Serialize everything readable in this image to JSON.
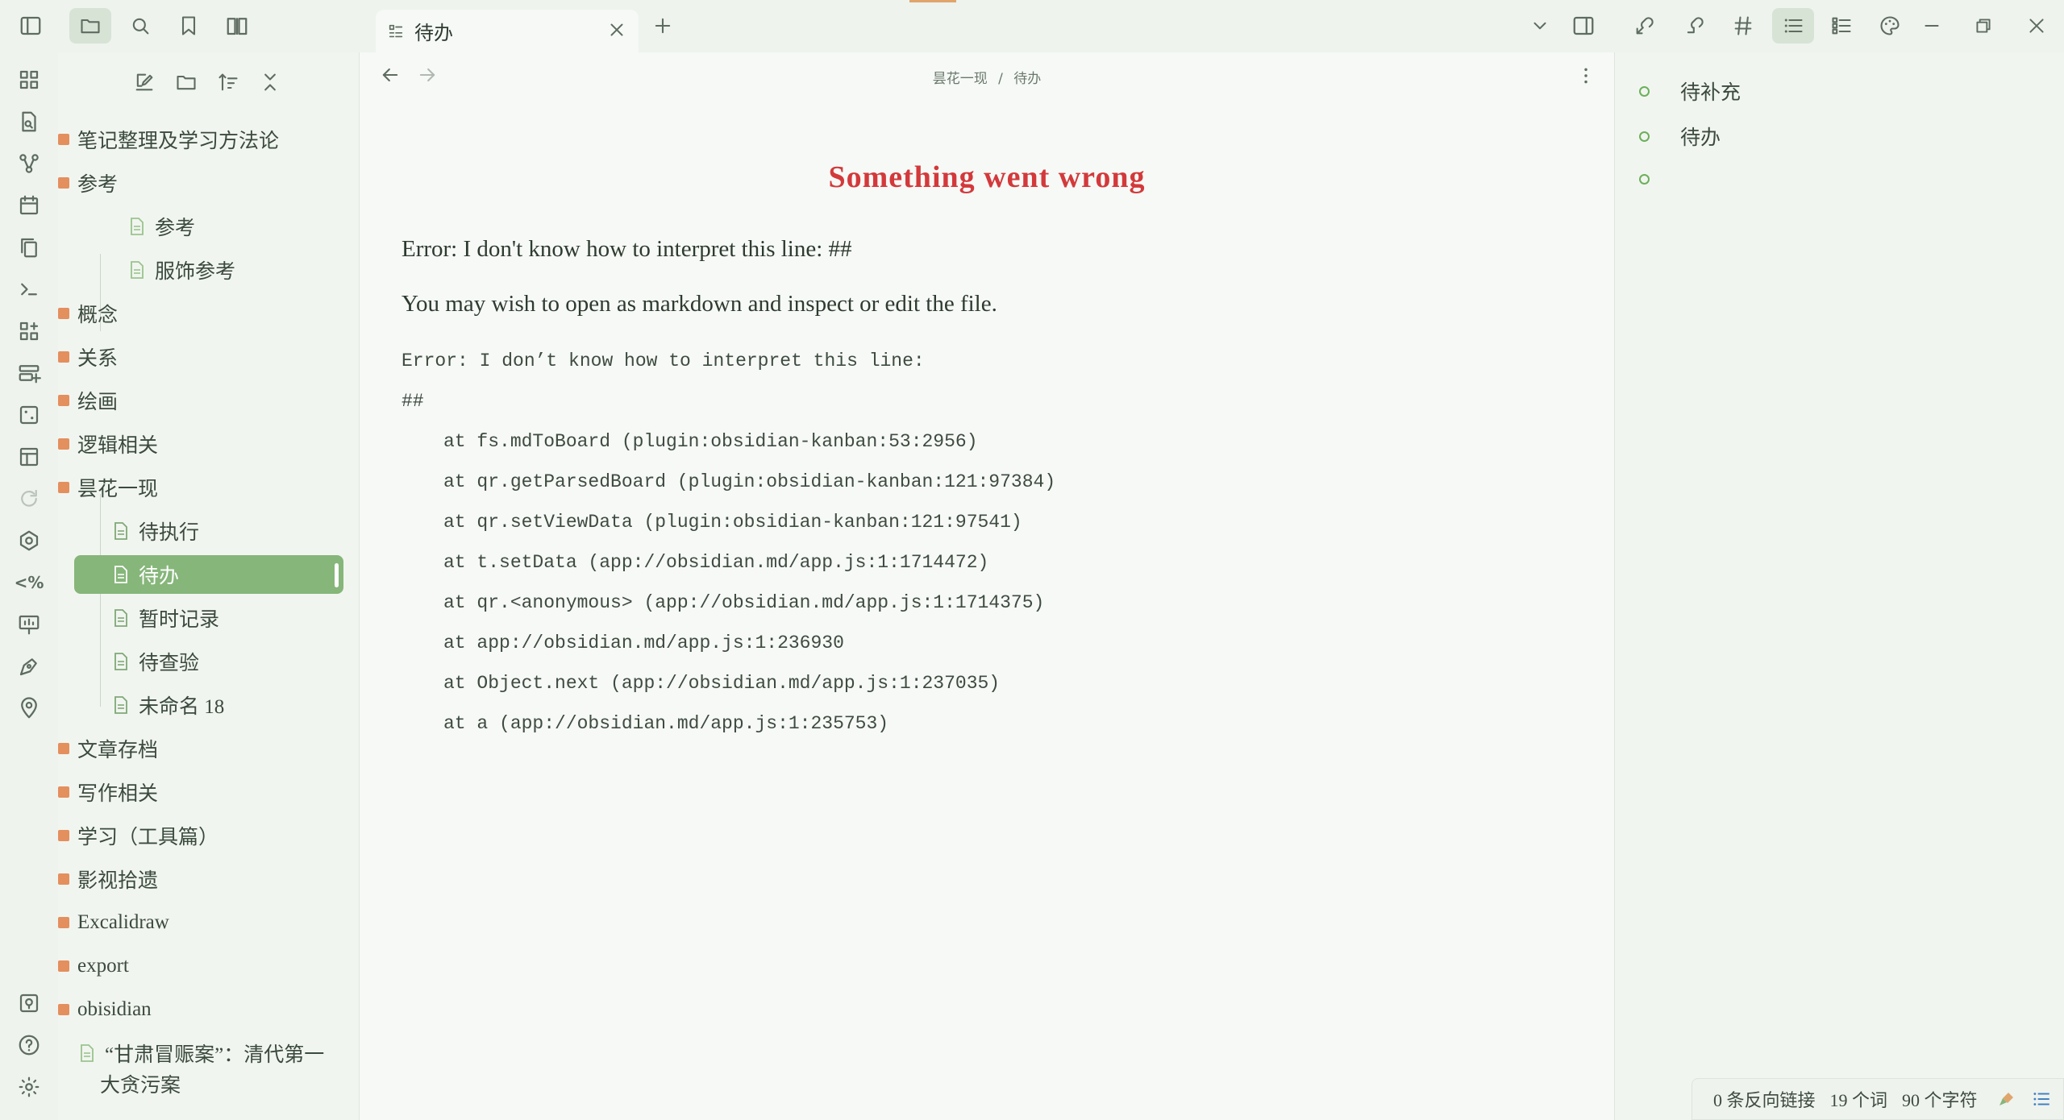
{
  "tab": {
    "title": "待办"
  },
  "breadcrumb": {
    "parent": "昙花一现",
    "separator": "/",
    "current": "待办"
  },
  "sidebar": {
    "items": [
      {
        "type": "folder",
        "label": "笔记整理及学习方法论"
      },
      {
        "type": "folder",
        "label": "参考"
      },
      {
        "type": "file",
        "label": "参考"
      },
      {
        "type": "file",
        "label": "服饰参考"
      },
      {
        "type": "folder",
        "label": "概念"
      },
      {
        "type": "folder",
        "label": "关系"
      },
      {
        "type": "folder",
        "label": "绘画"
      },
      {
        "type": "folder",
        "label": "逻辑相关"
      },
      {
        "type": "folder",
        "label": "昙花一现"
      },
      {
        "type": "file",
        "label": "待执行"
      },
      {
        "type": "file",
        "label": "待办"
      },
      {
        "type": "file",
        "label": "暂时记录"
      },
      {
        "type": "file",
        "label": "待查验"
      },
      {
        "type": "file",
        "label": "未命名 18"
      },
      {
        "type": "folder",
        "label": "文章存档"
      },
      {
        "type": "folder",
        "label": "写作相关"
      },
      {
        "type": "folder",
        "label": "学习（工具篇）"
      },
      {
        "type": "folder",
        "label": "影视拾遗"
      },
      {
        "type": "folder",
        "label": "Excalidraw"
      },
      {
        "type": "folder",
        "label": "export"
      },
      {
        "type": "folder",
        "label": "obisidian"
      },
      {
        "type": "file",
        "label": "“甘肃冒赈案”：清代第一"
      },
      {
        "type": "continuation",
        "label": "大贪污案"
      }
    ]
  },
  "main": {
    "error_title": "Something  went  wrong",
    "error_line": "Error: I don't know how to interpret this line: ##",
    "hint": "You may wish to open as markdown and inspect or edit the file.",
    "stack_header": "Error: I don’t know how to interpret this line:",
    "stack_hash": "##",
    "stack": [
      "at fs.mdToBoard (plugin:obsidian-kanban:53:2956)",
      "at qr.getParsedBoard (plugin:obsidian-kanban:121:97384)",
      "at qr.setViewData (plugin:obsidian-kanban:121:97541)",
      "at t.setData (app://obsidian.md/app.js:1:1714472)",
      "at qr.<anonymous> (app://obsidian.md/app.js:1:1714375)",
      "at app://obsidian.md/app.js:1:236930",
      "at Object.next (app://obsidian.md/app.js:1:237035)",
      "at a (app://obsidian.md/app.js:1:235753)"
    ]
  },
  "outline": {
    "items": [
      "待补充",
      "待办",
      ""
    ]
  },
  "status": {
    "backlinks": "0 条反向链接",
    "words": "19 个词",
    "chars": "90 个字符"
  },
  "colors": {
    "accent": "#86b67a",
    "error": "#d3393b",
    "folder": "#e48f5e"
  }
}
